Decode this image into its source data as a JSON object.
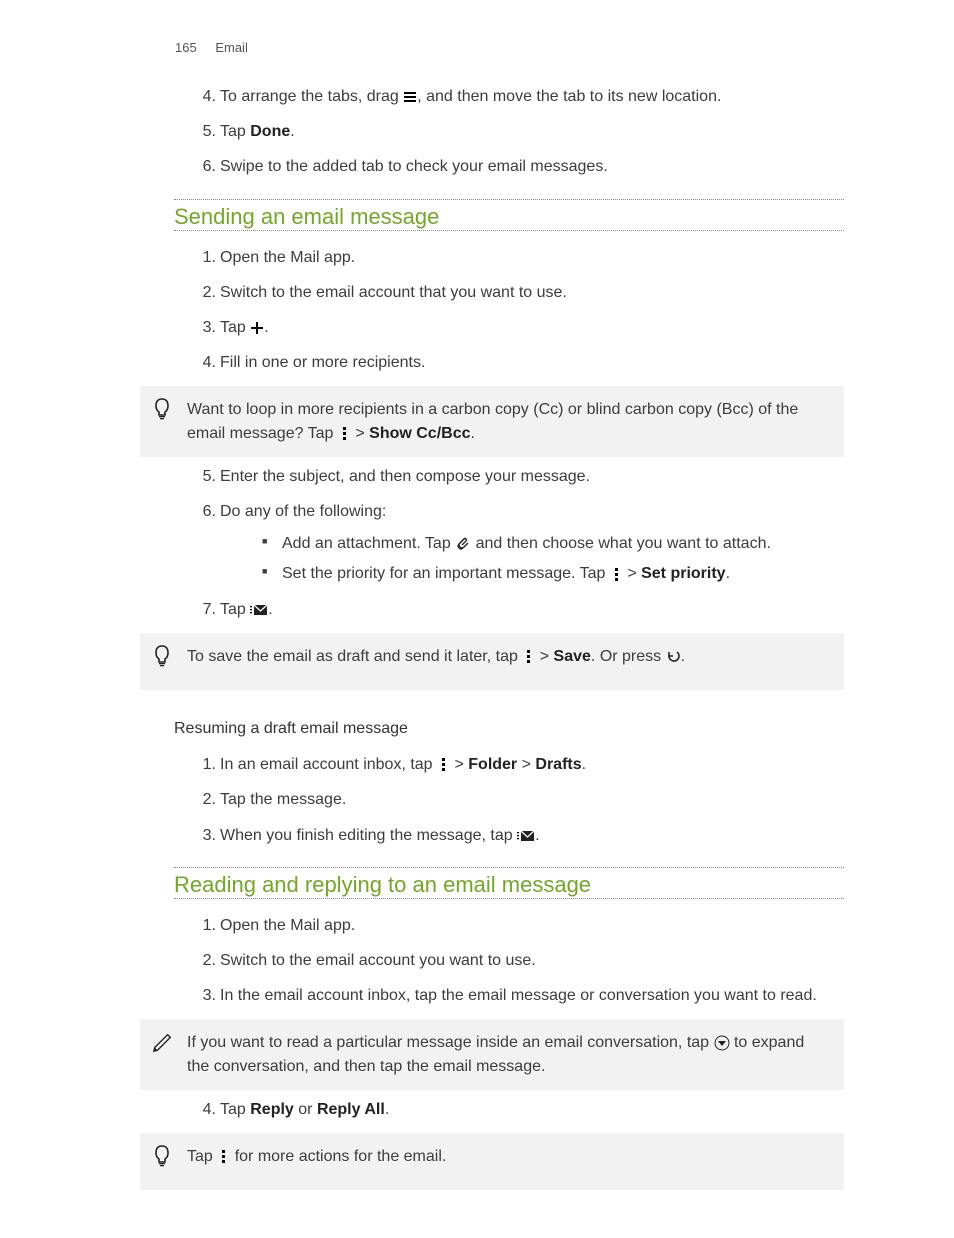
{
  "header": {
    "page_num": "165",
    "section": "Email"
  },
  "intro_steps": [
    {
      "n": "4.",
      "pre": "To arrange the tabs, drag ",
      "post": ", and then move the tab to its new location."
    },
    {
      "n": "5.",
      "pre": "Tap ",
      "bold": "Done",
      "post": "."
    },
    {
      "n": "6.",
      "text": "Swipe to the added tab to check your email messages."
    }
  ],
  "sec1": {
    "title": "Sending an email message",
    "steps_a": [
      {
        "n": "1.",
        "text": "Open the Mail app."
      },
      {
        "n": "2.",
        "text": "Switch to the email account that you want to use."
      },
      {
        "n": "3.",
        "pre": "Tap ",
        "post": "."
      },
      {
        "n": "4.",
        "text": "Fill in one or more recipients."
      }
    ],
    "tip1": {
      "pre": "Want to loop in more recipients in a carbon copy (Cc) or blind carbon copy (Bcc) of the email message? Tap ",
      "gt": " > ",
      "bold": "Show Cc/Bcc",
      "post": "."
    },
    "steps_b": [
      {
        "n": "5.",
        "text": "Enter the subject, and then compose your message."
      },
      {
        "n": "6.",
        "text": "Do any of the following:",
        "sub": [
          {
            "pre": "Add an attachment. Tap ",
            "post": " and then choose what you want to attach."
          },
          {
            "pre": "Set the priority for an important message. Tap ",
            "gt": " > ",
            "bold": "Set priority",
            "post": "."
          }
        ]
      },
      {
        "n": "7.",
        "pre": "Tap ",
        "post": "."
      }
    ],
    "tip2": {
      "pre": "To save the email as draft and send it later, tap ",
      "gt": " > ",
      "bold": "Save",
      "post_a": ". Or press ",
      "post_b": "."
    },
    "subheading": "Resuming a draft email message",
    "steps_c": [
      {
        "n": "1.",
        "pre": "In an email account inbox, tap ",
        "gt": " > ",
        "bold1": "Folder",
        "mid": " > ",
        "bold2": "Drafts",
        "post": "."
      },
      {
        "n": "2.",
        "text": "Tap the message."
      },
      {
        "n": "3.",
        "pre": "When you finish editing the message, tap ",
        "post": "."
      }
    ]
  },
  "sec2": {
    "title": "Reading and replying to an email message",
    "steps_a": [
      {
        "n": "1.",
        "text": "Open the Mail app."
      },
      {
        "n": "2.",
        "text": "Switch to the email account you want to use."
      },
      {
        "n": "3.",
        "text": "In the email account inbox, tap the email message or conversation you want to read."
      }
    ],
    "note": {
      "pre": "If you want to read a particular message inside an email conversation, tap ",
      "post": " to expand the conversation, and then tap the email message."
    },
    "steps_b": [
      {
        "n": "4.",
        "pre": "Tap ",
        "bold1": "Reply",
        "mid": " or ",
        "bold2": "Reply All",
        "post": "."
      }
    ],
    "tip": {
      "pre": "Tap ",
      "post": " for more actions for the email."
    }
  }
}
